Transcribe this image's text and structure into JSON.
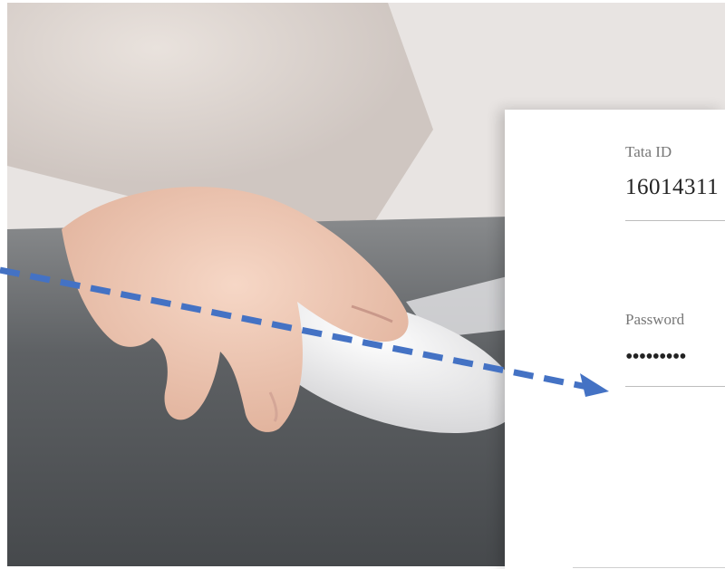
{
  "login": {
    "id_label": "Tata ID",
    "id_value": "16014311",
    "password_label": "Password",
    "password_value": "•••••••••"
  },
  "colors": {
    "arrow": "#4472c4",
    "card_background": "#ffffff"
  },
  "icons": {
    "pointer_arrow": "dashed-arrow-icon"
  }
}
